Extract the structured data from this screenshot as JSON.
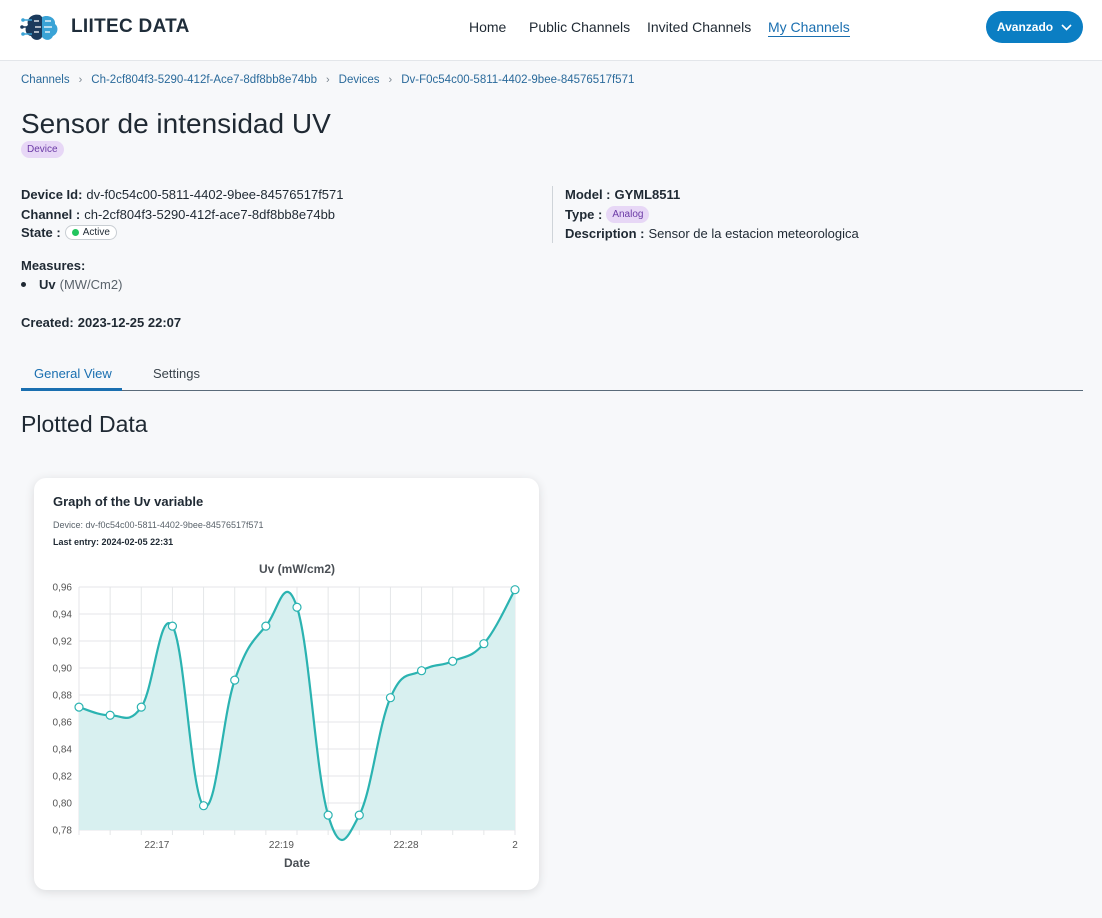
{
  "header": {
    "brand": "LIITEC DATA",
    "nav": [
      {
        "label": "Home",
        "active": false
      },
      {
        "label": "Public Channels",
        "active": false
      },
      {
        "label": "Invited Channels",
        "active": false
      },
      {
        "label": "My Channels",
        "active": true
      }
    ],
    "user_button": "Avanzado",
    "user_button_icon": "chevron-down-icon",
    "logo_icon": "brain-circuit-icon"
  },
  "breadcrumbs": [
    "Channels",
    "Ch-2cf804f3-5290-412f-Ace7-8df8bb8e74bb",
    "Devices",
    "Dv-F0c54c00-5811-4402-9bee-84576517f571"
  ],
  "device": {
    "title": "Sensor de intensidad UV",
    "badge": "Device",
    "id_label": "Device Id:",
    "id_value": "dv-f0c54c00-5811-4402-9bee-84576517f571",
    "channel_label": "Channel :",
    "channel_value": "ch-2cf804f3-5290-412f-ace7-8df8bb8e74bb",
    "state_label": "State :",
    "state_value": "Active",
    "state_color": "#22c55e",
    "model_label": "Model :",
    "model_value": "GYML8511",
    "type_label": "Type :",
    "type_value": "Analog",
    "description_label": "Description :",
    "description_value": "Sensor de la estacion meteorologica",
    "measures_label": "Measures:",
    "measures": [
      {
        "name": "Uv",
        "unit": "(MW/Cm2)"
      }
    ],
    "created_label": "Created:",
    "created_value": "2023-12-25 22:07"
  },
  "tabs": [
    {
      "label": "General View",
      "active": true
    },
    {
      "label": "Settings",
      "active": false
    }
  ],
  "section_title": "Plotted Data",
  "card": {
    "title": "Graph of the Uv variable",
    "device_line": "Device: dv-f0c54c00-5811-4402-9bee-84576517f571",
    "last_entry_label": "Last entry:",
    "last_entry_value": "2024-02-05 22:31"
  },
  "colors": {
    "accent": "#1a6fb0",
    "button": "#0b7ec3",
    "line": "#2bb3b1",
    "fill": "#d8f0f0",
    "badge_bg": "#e7d7f6"
  },
  "chart_data": {
    "type": "line",
    "title": "Uv (mW/cm2)",
    "xlabel": "Date",
    "ylabel": "",
    "ylim": [
      0.78,
      0.96
    ],
    "yticks": [
      "0,96",
      "0,94",
      "0,92",
      "0,90",
      "0,88",
      "0,86",
      "0,84",
      "0,82",
      "0,80",
      "0,78"
    ],
    "xtick_labels": [
      {
        "index": 2.5,
        "label": "22:17"
      },
      {
        "index": 6.5,
        "label": "22:19"
      },
      {
        "index": 10.5,
        "label": "22:28"
      },
      {
        "index": 14,
        "label": "2"
      }
    ],
    "values": [
      0.871,
      0.865,
      0.871,
      0.931,
      0.798,
      0.891,
      0.931,
      0.945,
      0.791,
      0.791,
      0.878,
      0.898,
      0.905,
      0.918,
      0.958
    ],
    "area_fill": true,
    "grid": true
  }
}
